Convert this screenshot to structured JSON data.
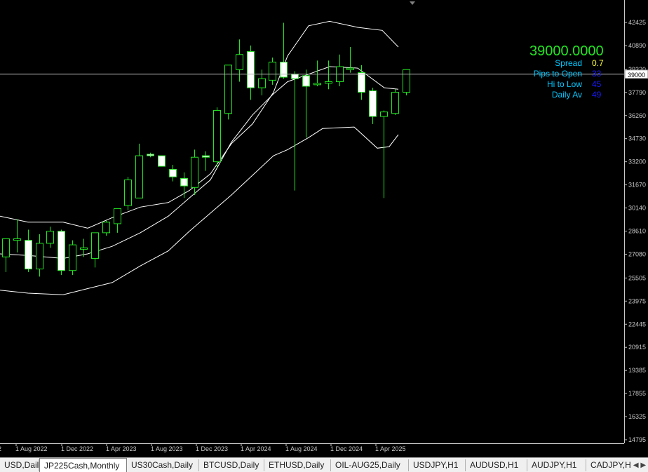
{
  "symbol": "JP225Cash",
  "timeframe": "Monthly",
  "current_price_label": "39000",
  "info_panel": {
    "price": "39000.0000",
    "rows": [
      {
        "label": "Spread",
        "value": "0.7",
        "color": "#ffff33"
      },
      {
        "label": "Pips to Open",
        "value": "33",
        "color": "#1a1aff"
      },
      {
        "label": "Hi to Low",
        "value": "45",
        "color": "#1a1aff"
      },
      {
        "label": "Daily Av",
        "value": "49",
        "color": "#1a1aff"
      }
    ]
  },
  "chart_data": {
    "type": "candlestick",
    "price_axis_labels": [
      "42425",
      "40890",
      "39320",
      "37790",
      "36260",
      "34730",
      "33200",
      "31670",
      "30140",
      "28610",
      "27080",
      "25505",
      "23975",
      "22445",
      "20915",
      "19385",
      "17855",
      "16325",
      "14795"
    ],
    "time_axis_labels": [
      "1 Aug 2022",
      "1 Dec 2022",
      "1 Apr 2023",
      "1 Aug 2023",
      "1 Dec 2023",
      "1 Apr 2024",
      "1 Aug 2024",
      "1 Dec 2024",
      "1 Apr 2025"
    ],
    "ylim": [
      14795,
      42425
    ],
    "candles": [
      {
        "o": 26900,
        "h": 27900,
        "l": 25900,
        "c": 28100
      },
      {
        "o": 28000,
        "h": 29400,
        "l": 27200,
        "c": 28100
      },
      {
        "o": 28000,
        "h": 28700,
        "l": 25900,
        "c": 26100
      },
      {
        "o": 26100,
        "h": 28400,
        "l": 25600,
        "c": 27800
      },
      {
        "o": 27800,
        "h": 28900,
        "l": 27500,
        "c": 28600
      },
      {
        "o": 28600,
        "h": 28700,
        "l": 25700,
        "c": 26000
      },
      {
        "o": 26000,
        "h": 28000,
        "l": 25700,
        "c": 27700
      },
      {
        "o": 27500,
        "h": 28100,
        "l": 26900,
        "c": 27500
      },
      {
        "o": 26800,
        "h": 28200,
        "l": 26200,
        "c": 28500
      },
      {
        "o": 28500,
        "h": 29300,
        "l": 28300,
        "c": 29200
      },
      {
        "o": 29100,
        "h": 30000,
        "l": 28500,
        "c": 30100
      },
      {
        "o": 30300,
        "h": 32200,
        "l": 30000,
        "c": 32000
      },
      {
        "o": 30800,
        "h": 34400,
        "l": 30800,
        "c": 33600
      },
      {
        "o": 33700,
        "h": 33800,
        "l": 33500,
        "c": 33600
      },
      {
        "o": 33600,
        "h": 33600,
        "l": 32900,
        "c": 32900
      },
      {
        "o": 32700,
        "h": 33000,
        "l": 31900,
        "c": 32200
      },
      {
        "o": 32100,
        "h": 32500,
        "l": 30800,
        "c": 31600
      },
      {
        "o": 31500,
        "h": 34000,
        "l": 31000,
        "c": 33500
      },
      {
        "o": 33600,
        "h": 33900,
        "l": 32600,
        "c": 33500
      },
      {
        "o": 33200,
        "h": 36800,
        "l": 32800,
        "c": 36600
      },
      {
        "o": 36400,
        "h": 39600,
        "l": 36000,
        "c": 39600
      },
      {
        "o": 39300,
        "h": 41300,
        "l": 38500,
        "c": 40300
      },
      {
        "o": 40500,
        "h": 40900,
        "l": 37300,
        "c": 38100
      },
      {
        "o": 38100,
        "h": 39300,
        "l": 37600,
        "c": 38700
      },
      {
        "o": 38600,
        "h": 40100,
        "l": 38300,
        "c": 39800
      },
      {
        "o": 39800,
        "h": 42400,
        "l": 38700,
        "c": 38800
      },
      {
        "o": 39000,
        "h": 39200,
        "l": 31300,
        "c": 38700
      },
      {
        "o": 38900,
        "h": 39300,
        "l": 34800,
        "c": 38200
      },
      {
        "o": 38300,
        "h": 39900,
        "l": 38200,
        "c": 38400
      },
      {
        "o": 38400,
        "h": 39900,
        "l": 38000,
        "c": 38500
      },
      {
        "o": 38500,
        "h": 40300,
        "l": 38200,
        "c": 39500
      },
      {
        "o": 39300,
        "h": 40800,
        "l": 39100,
        "c": 39400
      },
      {
        "o": 39100,
        "h": 39600,
        "l": 37300,
        "c": 37800
      },
      {
        "o": 37900,
        "h": 38100,
        "l": 35700,
        "c": 36200
      },
      {
        "o": 36200,
        "h": 36600,
        "l": 30800,
        "c": 36500
      },
      {
        "o": 36400,
        "h": 38000,
        "l": 36300,
        "c": 37800
      },
      {
        "o": 37800,
        "h": 39300,
        "l": 37600,
        "c": 39300
      }
    ],
    "bands": {
      "upper": [
        [
          0,
          29600
        ],
        [
          40,
          29200
        ],
        [
          90,
          29200
        ],
        [
          125,
          28800
        ],
        [
          160,
          29500
        ],
        [
          200,
          30200
        ],
        [
          240,
          30500
        ],
        [
          270,
          31300
        ],
        [
          300,
          32400
        ],
        [
          330,
          34400
        ],
        [
          360,
          35700
        ],
        [
          390,
          37800
        ],
        [
          410,
          40200
        ],
        [
          440,
          42200
        ],
        [
          470,
          42500
        ],
        [
          510,
          42100
        ],
        [
          545,
          41900
        ],
        [
          568,
          40800
        ]
      ],
      "middle": [
        [
          0,
          27100
        ],
        [
          40,
          27000
        ],
        [
          90,
          26800
        ],
        [
          125,
          27100
        ],
        [
          160,
          27600
        ],
        [
          200,
          28500
        ],
        [
          240,
          29600
        ],
        [
          270,
          30800
        ],
        [
          300,
          32000
        ],
        [
          330,
          34500
        ],
        [
          360,
          36300
        ],
        [
          390,
          37700
        ],
        [
          410,
          38500
        ],
        [
          440,
          39000
        ],
        [
          470,
          39500
        ],
        [
          510,
          39400
        ],
        [
          548,
          38100
        ],
        [
          568,
          38000
        ]
      ],
      "lower": [
        [
          0,
          24700
        ],
        [
          40,
          24500
        ],
        [
          90,
          24400
        ],
        [
          125,
          24800
        ],
        [
          160,
          25200
        ],
        [
          200,
          26300
        ],
        [
          240,
          27300
        ],
        [
          270,
          28600
        ],
        [
          300,
          29800
        ],
        [
          330,
          31000
        ],
        [
          360,
          32300
        ],
        [
          390,
          33600
        ],
        [
          410,
          34000
        ],
        [
          440,
          34800
        ],
        [
          460,
          35400
        ],
        [
          505,
          35500
        ],
        [
          538,
          34100
        ],
        [
          555,
          34200
        ],
        [
          568,
          35000
        ]
      ]
    }
  },
  "tabs": [
    {
      "label": "USD,Daily",
      "active": false
    },
    {
      "label": "JP225Cash,Monthly",
      "active": true
    },
    {
      "label": "US30Cash,Daily",
      "active": false
    },
    {
      "label": "BTCUSD,Daily",
      "active": false
    },
    {
      "label": "ETHUSD,Daily",
      "active": false
    },
    {
      "label": "OIL-AUG25,Daily",
      "active": false
    },
    {
      "label": "USDJPY,H1",
      "active": false
    },
    {
      "label": "AUDUSD,H1",
      "active": false
    },
    {
      "label": "AUDJPY,H1",
      "active": false
    },
    {
      "label": "CADJPY,H",
      "active": false
    }
  ],
  "tab_arrows": "◀ ▶"
}
